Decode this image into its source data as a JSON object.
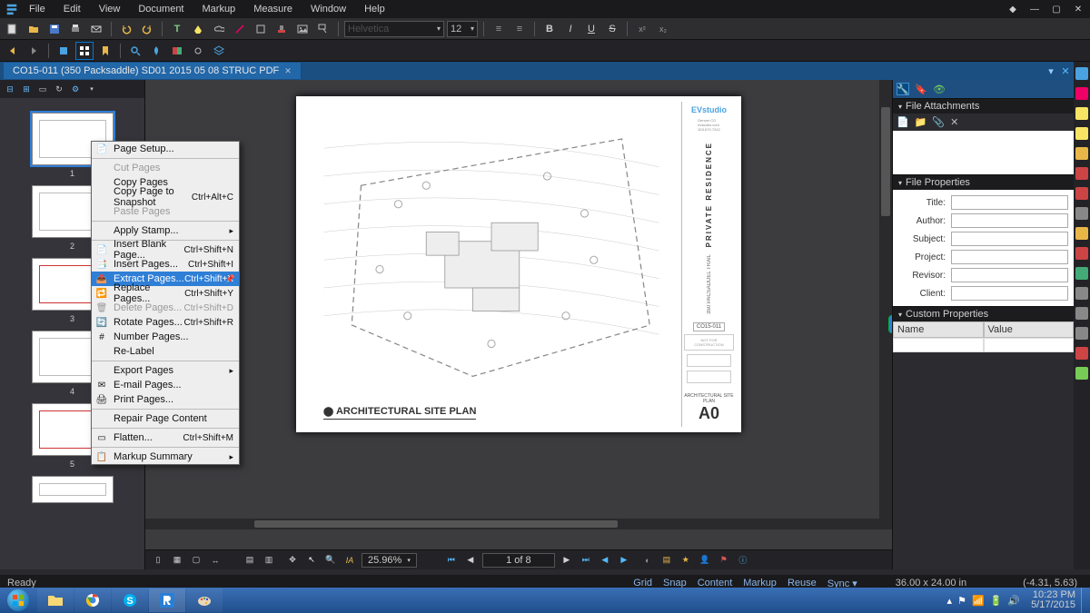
{
  "menubar": {
    "items": [
      "File",
      "Edit",
      "View",
      "Document",
      "Markup",
      "Measure",
      "Window",
      "Help"
    ]
  },
  "tab": {
    "title": "CO15-011 (350 Packsaddle) SD01 2015 05 08 STRUC PDF"
  },
  "context_menu": {
    "items": [
      {
        "label": "Page Setup...",
        "icon": "📄"
      },
      {
        "sep": true
      },
      {
        "label": "Cut Pages",
        "disabled": true
      },
      {
        "label": "Copy Pages"
      },
      {
        "label": "Copy Page to Snapshot",
        "shortcut": "Ctrl+Alt+C"
      },
      {
        "label": "Paste Pages",
        "disabled": true
      },
      {
        "sep": true
      },
      {
        "label": "Apply Stamp...",
        "submenu": true
      },
      {
        "sep": true
      },
      {
        "label": "Insert Blank Page...",
        "shortcut": "Ctrl+Shift+N",
        "icon": "📄"
      },
      {
        "label": "Insert Pages...",
        "shortcut": "Ctrl+Shift+I",
        "icon": "📑"
      },
      {
        "label": "Extract Pages...",
        "shortcut": "Ctrl+Shift+X",
        "icon": "📤",
        "selected": true,
        "pin": true
      },
      {
        "label": "Replace Pages...",
        "shortcut": "Ctrl+Shift+Y",
        "icon": "🔁"
      },
      {
        "label": "Delete Pages...",
        "shortcut": "Ctrl+Shift+D",
        "icon": "🗑",
        "disabled": true
      },
      {
        "label": "Rotate Pages...",
        "shortcut": "Ctrl+Shift+R",
        "icon": "🔄"
      },
      {
        "label": "Number Pages...",
        "icon": "#"
      },
      {
        "label": "Re-Label"
      },
      {
        "sep": true
      },
      {
        "label": "Export Pages",
        "submenu": true
      },
      {
        "label": "E-mail Pages...",
        "icon": "✉"
      },
      {
        "label": "Print Pages...",
        "icon": "🖨"
      },
      {
        "sep": true
      },
      {
        "label": "Repair Page Content"
      },
      {
        "sep": true
      },
      {
        "label": "Flatten...",
        "shortcut": "Ctrl+Shift+M",
        "icon": "▭"
      },
      {
        "sep": true
      },
      {
        "label": "Markup Summary",
        "submenu": true,
        "icon": "📋"
      }
    ]
  },
  "thumbnails": {
    "count": 6
  },
  "nav": {
    "zoom": "25.96%",
    "page": "1 of 8"
  },
  "rightpanel": {
    "attachments_title": "File Attachments",
    "fileprops_title": "File Properties",
    "fields": {
      "title": "Title:",
      "author": "Author:",
      "subject": "Subject:",
      "project": "Project:",
      "revisor": "Revisor:",
      "client": "Client:"
    },
    "custprops_title": "Custom Properties",
    "cust_cols": {
      "name": "Name",
      "value": "Value"
    }
  },
  "page_content": {
    "logo": "EVstudio",
    "proj_title": "PRIVATE RESIDENCE",
    "proj_sub": "350 PACSADDEL TRAIL",
    "proj_num": "CO15-011",
    "stamp": "NOT FOR CONSTRUCTION",
    "sheet_name": "ARCHITECTURAL SITE PLAN",
    "sheet_num": "A0",
    "plan_title": "ARCHITECTURAL SITE PLAN"
  },
  "status": {
    "ready": "Ready",
    "grid": "Grid",
    "snap": "Snap",
    "content": "Content",
    "markup": "Markup",
    "reuse": "Reuse",
    "sync": "Sync ▾",
    "size": "36.00 x 24.00 in",
    "coords": "(-4.31, 5.63)"
  },
  "taskbar": {
    "time": "10:23 PM",
    "date": "5/17/2015"
  },
  "toolbar": {
    "font_size": "12"
  }
}
